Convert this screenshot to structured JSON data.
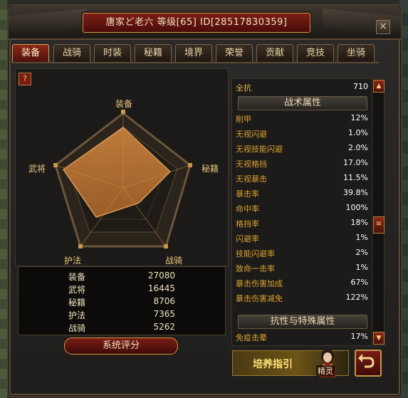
{
  "window": {
    "title": "唐家ど老六  等级[65]  ID[28517830359]",
    "close_label": "×"
  },
  "tabs": [
    {
      "label": "装备"
    },
    {
      "label": "战骑"
    },
    {
      "label": "时装"
    },
    {
      "label": "秘籍"
    },
    {
      "label": "境界"
    },
    {
      "label": "荣誉"
    },
    {
      "label": "贡献"
    },
    {
      "label": "竞技"
    },
    {
      "label": "坐骑"
    }
  ],
  "help_label": "?",
  "radar": {
    "labels": [
      "装备",
      "秘籍",
      "战骑",
      "护法",
      "武将"
    ]
  },
  "stats": [
    {
      "name": "装备",
      "value": "27080"
    },
    {
      "name": "武将",
      "value": "16445"
    },
    {
      "name": "秘籍",
      "value": "8706"
    },
    {
      "name": "护法",
      "value": "7365"
    },
    {
      "name": "战骑",
      "value": "5262"
    }
  ],
  "rating_button": "系统评分",
  "attributes": {
    "top": {
      "name": "全抗",
      "value": "710"
    },
    "section1": "战术属性",
    "list1": [
      {
        "name": "削甲",
        "value": "12%"
      },
      {
        "name": "无视闪避",
        "value": "1.0%"
      },
      {
        "name": "无视技能闪避",
        "value": "2.0%"
      },
      {
        "name": "无视格挡",
        "value": "17.0%"
      },
      {
        "name": "无视暴击",
        "value": "11.5%"
      },
      {
        "name": "暴击率",
        "value": "39.8%"
      },
      {
        "name": "命中率",
        "value": "100%"
      },
      {
        "name": "格挡率",
        "value": "18%"
      },
      {
        "name": "闪避率",
        "value": "1%"
      },
      {
        "name": "技能闪避率",
        "value": "2%"
      },
      {
        "name": "致命一击率",
        "value": "1%"
      },
      {
        "name": "暴击伤害加成",
        "value": "67%"
      },
      {
        "name": "暴击伤害减免",
        "value": "122%"
      }
    ],
    "section2": "抗性与特殊属性",
    "list2": [
      {
        "name": "免疫击晕",
        "value": "17%"
      }
    ]
  },
  "scroll": {
    "up": "▲",
    "thumb": "≡",
    "down": "▼"
  },
  "cultivate": {
    "label": "培养指引",
    "sprite_label": "精灵"
  },
  "icons": {
    "return": "return-arrow-icon"
  }
}
